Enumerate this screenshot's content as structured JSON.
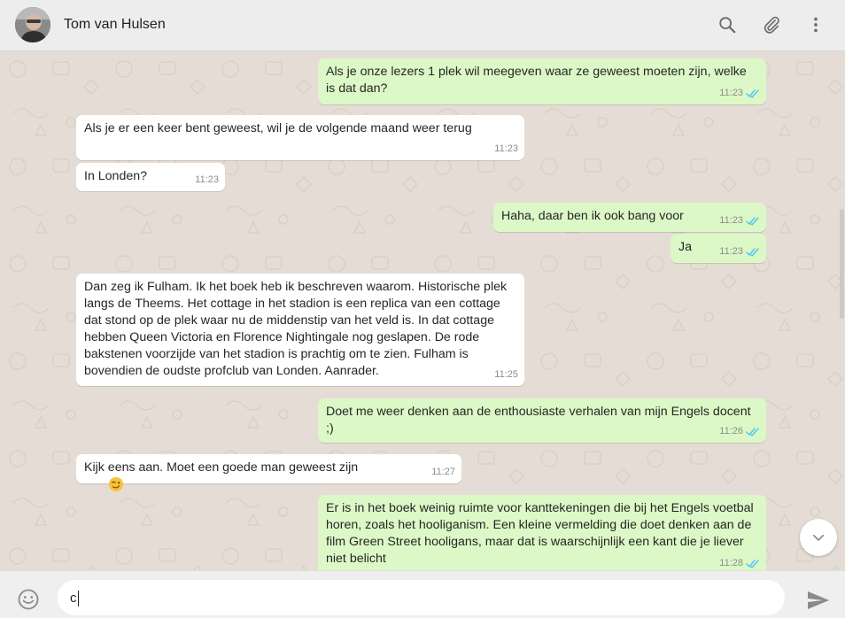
{
  "header": {
    "contact_name": "Tom van Hulsen",
    "icons": [
      "search-icon",
      "paperclip-icon",
      "menu-kebab-icon"
    ]
  },
  "messages": [
    {
      "direction": "out",
      "text": "Als je onze lezers 1 plek wil meegeven waar ze geweest moeten zijn, welke is dat dan?",
      "time": "11:23",
      "status": "read"
    },
    {
      "direction": "in",
      "text": "Als je er een keer bent geweest, wil je de volgende maand weer terug",
      "time": "11:23"
    },
    {
      "direction": "in",
      "text": "In Londen?",
      "time": "11:23"
    },
    {
      "direction": "out",
      "text": "Haha, daar ben ik ook bang voor",
      "time": "11:23",
      "status": "read"
    },
    {
      "direction": "out",
      "text": "Ja",
      "time": "11:23",
      "status": "read"
    },
    {
      "direction": "in",
      "text": "Dan zeg ik Fulham. Ik het boek heb ik beschreven waarom. Historische plek langs de Theems. Het cottage in het stadion is een replica van een cottage dat stond op de plek waar nu de middenstip van het veld is. In dat cottage hebben Queen Victoria en Florence Nightingale nog geslapen. De rode bakstenen voorzijde van het stadion is prachtig om te zien. Fulham is bovendien de oudste profclub van Londen. Aanrader.",
      "time": "11:25"
    },
    {
      "direction": "out",
      "text": "Doet me weer denken aan de enthousiaste verhalen van mijn Engels docent ;)",
      "time": "11:26",
      "status": "read"
    },
    {
      "direction": "in",
      "text": "Kijk eens aan. Moet een goede man geweest zijn",
      "emoji": "wink",
      "time": "11:27"
    },
    {
      "direction": "out",
      "text": "Er is in het boek weinig ruimte voor kanttekeningen die bij het Engels voetbal horen, zoals het hooliganism. Een kleine vermelding die doet denken aan de film Green Street hooligans, maar dat is waarschijnlijk een kant die je liever niet belicht",
      "time": "11:28",
      "status": "read"
    }
  ],
  "composer": {
    "value": "c",
    "icons": [
      "emoji-icon",
      "send-icon"
    ]
  },
  "colors": {
    "incoming": "#ffffff",
    "outgoing": "#dcf8c6",
    "read_tick": "#4fc3f7",
    "chat_bg": "#e5ddd5"
  }
}
